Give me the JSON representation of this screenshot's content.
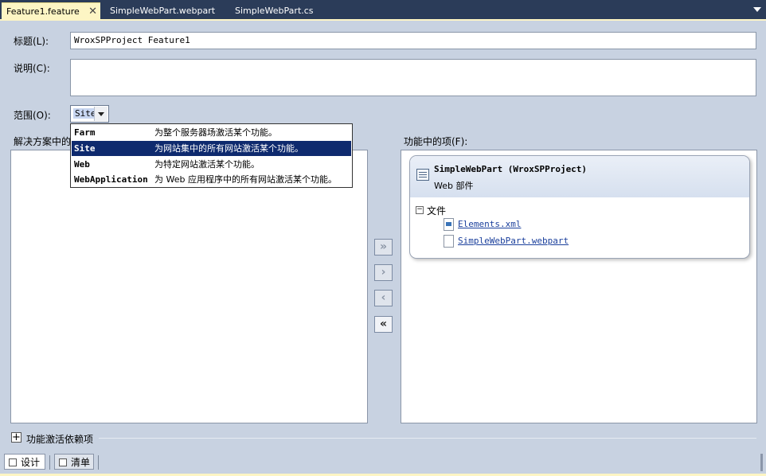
{
  "tabs": [
    {
      "label": "Feature1.feature",
      "active": true
    },
    {
      "label": "SimpleWebPart.webpart",
      "active": false
    },
    {
      "label": "SimpleWebPart.cs",
      "active": false
    }
  ],
  "form": {
    "title_label": "标题(L):",
    "title_value": "WroxSPProject Feature1",
    "description_label": "说明(C):",
    "description_value": "",
    "scope_label": "范围(O):",
    "scope_value": "Site"
  },
  "scope_options": [
    {
      "name": "Farm",
      "description": "为整个服务器场激活某个功能。",
      "selected": false
    },
    {
      "name": "Site",
      "description": "为网站集中的所有网站激活某个功能。",
      "selected": true
    },
    {
      "name": "Web",
      "description": "为特定网站激活某个功能。",
      "selected": false
    },
    {
      "name": "WebApplication",
      "description": "为 Web 应用程序中的所有网站激活某个功能。",
      "selected": false
    }
  ],
  "left_panel": {
    "label": "解决方案中的"
  },
  "right_panel": {
    "label": "功能中的项(F):",
    "item": {
      "title": "SimpleWebPart (WroxSPProject)",
      "subtitle": "Web 部件",
      "files_label": "文件",
      "files_toggle": "−",
      "files": [
        "Elements.xml",
        "SimpleWebPart.webpart"
      ]
    }
  },
  "move_buttons": {
    "add_all": "»",
    "add": "›",
    "remove": "‹",
    "remove_all": "«"
  },
  "dependencies": {
    "toggle": "+",
    "label": "功能激活依赖项"
  },
  "bottom_tabs": [
    {
      "label": "设计",
      "active": true
    },
    {
      "label": "清单",
      "active": false
    }
  ],
  "icons": {
    "tab_close": "close-icon",
    "tab_overflow": "chevron-down-icon",
    "scope_dropdown": "chevron-down-icon",
    "item": "webpart-icon",
    "file_xml": "xml-file-icon",
    "file_generic": "file-icon"
  },
  "colors": {
    "tab_bar": "#2b3c59",
    "active_tab": "#fdf5c4",
    "background": "#c8d2e1",
    "selection": "#0e2a6e",
    "link": "#1a3f9c"
  }
}
